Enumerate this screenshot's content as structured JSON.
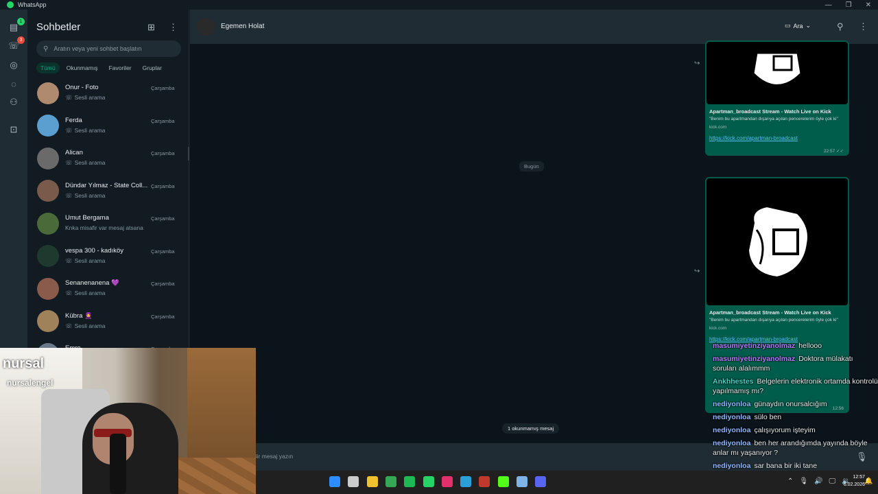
{
  "window": {
    "title": "WhatsApp",
    "controls": [
      "—",
      "❐",
      "✕"
    ]
  },
  "rail": {
    "items": [
      {
        "icon": "chats-icon",
        "glyph": "▤",
        "badge": "1",
        "badge_color": "green"
      },
      {
        "icon": "calls-icon",
        "glyph": "☏",
        "badge": "3",
        "badge_color": "red"
      },
      {
        "icon": "status-icon",
        "glyph": "◎",
        "badge": "",
        "badge_color": ""
      },
      {
        "icon": "channels-icon",
        "glyph": "◌",
        "badge": "",
        "badge_color": ""
      },
      {
        "icon": "communities-icon",
        "glyph": "⚇",
        "badge": "",
        "badge_color": ""
      },
      {
        "icon": "archive-icon",
        "glyph": "⊡",
        "badge": "",
        "badge_color": ""
      }
    ]
  },
  "sidebar": {
    "title": "Sohbetler",
    "search_placeholder": "Aratın veya yeni sohbet başlatın",
    "filters": [
      "Tümü",
      "Okunmamış",
      "Favoriler",
      "Gruplar"
    ],
    "chats": [
      {
        "name": "Onur - Foto",
        "sub": "Sesli arama",
        "time": "Çarşamba",
        "call": true,
        "color": "#b08a6e"
      },
      {
        "name": "Ferda",
        "sub": "Sesli arama",
        "time": "Çarşamba",
        "call": true,
        "color": "#5a9fd0"
      },
      {
        "name": "Alican",
        "sub": "Sesli arama",
        "time": "Çarşamba",
        "call": true,
        "color": "#6a6a6a"
      },
      {
        "name": "Dündar Yılmaz - State Coll...",
        "sub": "Sesli arama",
        "time": "Çarşamba",
        "call": true,
        "color": "#7a5a4a"
      },
      {
        "name": "Umut Bergama",
        "sub": "Knka misafir var mesaj atsana",
        "time": "Çarşamba",
        "call": false,
        "color": "#4a6a3a"
      },
      {
        "name": "vespa 300 - kadıköy",
        "sub": "Sesli arama",
        "time": "Çarşamba",
        "call": true,
        "color": "#1e3a2e"
      },
      {
        "name": "Senanenanena 💜",
        "sub": "Sesli arama",
        "time": "Çarşamba",
        "call": true,
        "color": "#8a5a4a"
      },
      {
        "name": "Kübra 🧕",
        "sub": "Sesli arama",
        "time": "Çarşamba",
        "call": true,
        "color": "#a0825a"
      },
      {
        "name": "Emre",
        "sub": "",
        "time": "Çarşamba",
        "call": false,
        "color": "#6a7a8a"
      }
    ]
  },
  "conversation": {
    "contact_name": "Egemen Holat",
    "call_label": "Ara",
    "date_separator": "Bugün",
    "unread_separator": "1 okunmamış mesaj",
    "composer_placeholder": "Bir mesaj yazın",
    "messages": [
      {
        "title": "Apartman_broadcast Stream - Watch Live on Kick",
        "desc": "\"Benim bu apartmandan dışarıya açılan pencerelerim öyle çok ki\"",
        "domain": "kick.com",
        "link": "https://kick.com/apartman-broadcast",
        "time": "22:57"
      },
      {
        "title": "Apartman_broadcast Stream - Watch Live on Kick",
        "desc": "\"Benim bu apartmandan dışarıya açılan pencerelerim öyle çok ki\"",
        "domain": "kick.com",
        "link": "https://kick.com/apartman-broadcast",
        "time": "12:56"
      }
    ]
  },
  "stream_chat": [
    {
      "user": "masumiyetinziyanolmaz",
      "color": "#b57bff",
      "text": "hellooo"
    },
    {
      "user": "masumiyetinziyanolmaz",
      "color": "#b57bff",
      "text": "Doktora mülakatı soruları alalımmm"
    },
    {
      "user": "Ankhhestes",
      "color": "#4fd1c5",
      "text": "Belgelerin elektronik ortamda kontrolü yapılmamış mı?"
    },
    {
      "user": "nediyonloa",
      "color": "#8fb8ff",
      "text": "günaydın onursalcığım"
    },
    {
      "user": "nediyonloa",
      "color": "#8fb8ff",
      "text": "sülo ben"
    },
    {
      "user": "nediyonloa",
      "color": "#8fb8ff",
      "text": "çalışıyorum işteyim"
    },
    {
      "user": "nediyonloa",
      "color": "#8fb8ff",
      "text": "ben her arandığımda yayında böyle anlar mı yaşanıyor ?"
    },
    {
      "user": "nediyonloa",
      "color": "#8fb8ff",
      "text": "sar bana bir iki tane"
    }
  ],
  "webcam": {
    "overlay_name": "nursal",
    "overlay_handle": "nursalengel"
  },
  "taskbar": {
    "apps": [
      {
        "name": "start-icon",
        "color": "#2d8cff"
      },
      {
        "name": "taskview-icon",
        "color": "#cccccc"
      },
      {
        "name": "explorer-icon",
        "color": "#f2c12e"
      },
      {
        "name": "chrome-icon",
        "color": "#34a853"
      },
      {
        "name": "spotify-icon",
        "color": "#1db954"
      },
      {
        "name": "whatsapp-taskbar-icon",
        "color": "#25d366"
      },
      {
        "name": "instagram-icon",
        "color": "#e1306c"
      },
      {
        "name": "edge-icon",
        "color": "#2b9fd9"
      },
      {
        "name": "app-icon",
        "color": "#c0392b"
      },
      {
        "name": "kick-icon",
        "color": "#53fc18"
      },
      {
        "name": "settings-icon",
        "color": "#7fb2e5"
      },
      {
        "name": "discord-icon",
        "color": "#5865f2"
      }
    ],
    "tray": [
      "⌃",
      "🎙",
      "🔊",
      "🖵",
      "🔉"
    ],
    "clock_time": "12:57",
    "clock_date": "6.02.2026"
  }
}
